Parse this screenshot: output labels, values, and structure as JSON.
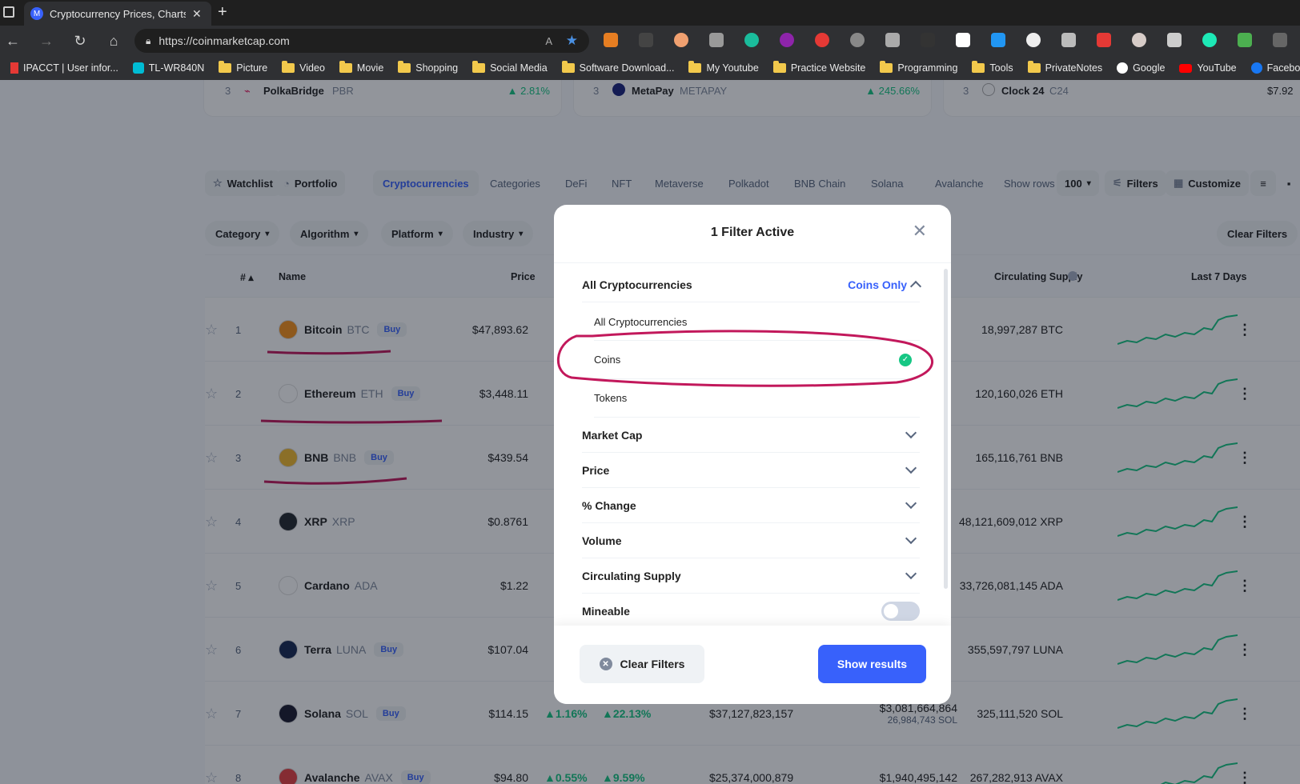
{
  "browser": {
    "tab_title": "Cryptocurrency Prices, Charts An",
    "url": "https://coinmarketcap.com",
    "bookmarks": [
      "IPACCT | User infor...",
      "TL-WR840N",
      "Picture",
      "Video",
      "Movie",
      "Shopping",
      "Social Media",
      "Software Download...",
      "My Youtube",
      "Practice Website",
      "Programming",
      "Tools",
      "PrivateNotes",
      "Google",
      "YouTube",
      "Facebook"
    ]
  },
  "top_cards": [
    {
      "rank": "3",
      "name": "PolkaBridge",
      "symbol": "PBR",
      "change": "2.81%"
    },
    {
      "rank": "3",
      "name": "MetaPay",
      "symbol": "METAPAY",
      "change": "245.66%"
    },
    {
      "rank": "3",
      "name": "Clock 24",
      "symbol": "C24",
      "value": "$7.92"
    }
  ],
  "nav": {
    "watchlist": "Watchlist",
    "portfolio": "Portfolio",
    "tabs": [
      "Cryptocurrencies",
      "Categories",
      "DeFi",
      "NFT",
      "Metaverse",
      "Polkadot",
      "BNB Chain",
      "Solana",
      "Avalanche"
    ],
    "show_rows_label": "Show rows",
    "show_rows_value": "100",
    "filters": "Filters",
    "customize": "Customize"
  },
  "filter_chips": [
    "Category",
    "Algorithm",
    "Platform",
    "Industry"
  ],
  "clear_filters_top": "Clear Filters",
  "table": {
    "headers": {
      "rank": "#",
      "name": "Name",
      "price": "Price",
      "supply": "Circulating Supply",
      "last7": "Last 7 Days"
    },
    "buy_label": "Buy",
    "rows": [
      {
        "rank": "1",
        "name": "Bitcoin",
        "symbol": "BTC",
        "price": "$47,893.62",
        "supply": "18,997,287 BTC",
        "color": "#f7931a",
        "buy": true
      },
      {
        "rank": "2",
        "name": "Ethereum",
        "symbol": "ETH",
        "price": "$3,448.11",
        "supply": "120,160,026 ETH",
        "color": "#ffffff",
        "buy": true
      },
      {
        "rank": "3",
        "name": "BNB",
        "symbol": "BNB",
        "price": "$439.54",
        "supply": "165,116,761 BNB",
        "color": "#f3ba2f",
        "buy": true
      },
      {
        "rank": "4",
        "name": "XRP",
        "symbol": "XRP",
        "price": "$0.8761",
        "supply": "48,121,609,012 XRP",
        "color": "#23292f",
        "buy": false
      },
      {
        "rank": "5",
        "name": "Cardano",
        "symbol": "ADA",
        "price": "$1.22",
        "supply": "33,726,081,145 ADA",
        "color": "#ffffff",
        "buy": false
      },
      {
        "rank": "6",
        "name": "Terra",
        "symbol": "LUNA",
        "price": "$107.04",
        "supply": "355,597,797 LUNA",
        "color": "#172852",
        "buy": true
      },
      {
        "rank": "7",
        "name": "Solana",
        "symbol": "SOL",
        "price": "$114.15",
        "change1h": "1.16%",
        "change24h": "22.13%",
        "mcap": "$37,127,823,157",
        "volume": "$3,081,664,864",
        "volume_sub": "26,984,743 SOL",
        "supply": "325,111,520 SOL",
        "color": "#1b1b2f",
        "buy": true
      },
      {
        "rank": "8",
        "name": "Avalanche",
        "symbol": "AVAX",
        "price": "$94.80",
        "change1h": "0.55%",
        "change24h": "9.59%",
        "mcap": "$25,374,000,879",
        "volume": "$1,940,495,142",
        "supply": "267,282,913 AVAX",
        "color": "#e84142",
        "buy": true
      }
    ]
  },
  "modal": {
    "title": "1 Filter Active",
    "section": "All Cryptocurrencies",
    "section_value": "Coins Only",
    "options": [
      "All Cryptocurrencies",
      "Coins",
      "Tokens"
    ],
    "selected": "Coins",
    "filters": [
      "Market Cap",
      "Price",
      "% Change",
      "Volume",
      "Circulating Supply"
    ],
    "mineable": "Mineable",
    "mineable_on": false,
    "clear_filters": "Clear Filters",
    "show_results": "Show results"
  },
  "colors": {
    "accent": "#3861fb",
    "annotation": "#c2185b",
    "green": "#16c784"
  }
}
